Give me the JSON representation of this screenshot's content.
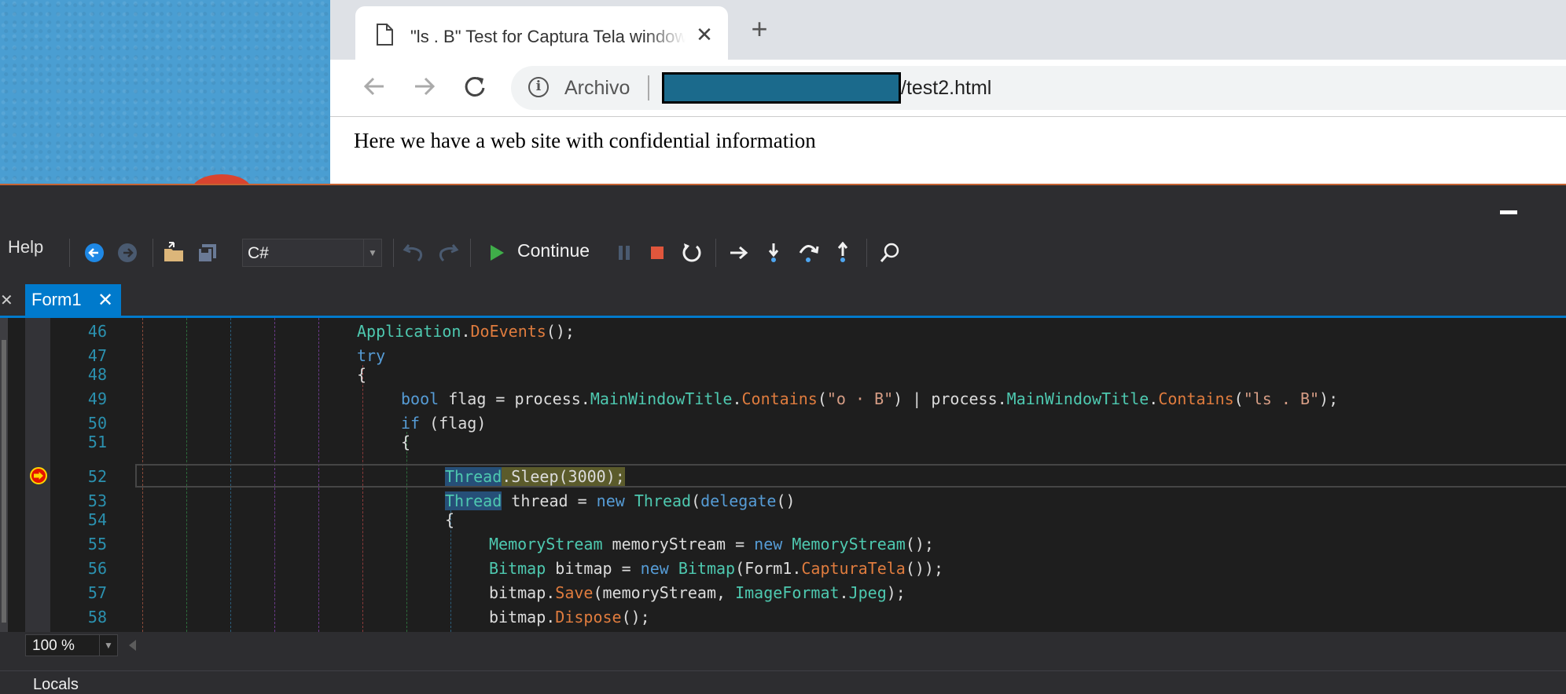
{
  "browser": {
    "tab_title": "\"ls . B\" Test for Captura Tela window",
    "tab_close": "✕",
    "new_tab": "+",
    "scheme_label": "Archivo",
    "url_path": "/test2.html",
    "page_text": "Here we have a web site with confidential information"
  },
  "ide": {
    "menu_help": "Help",
    "language": "C#",
    "continue_label": "Continue",
    "doc_tab": "Form1",
    "doc_tab_close": "✕",
    "zoom": "100 %",
    "locals_label": "Locals",
    "breakpoint_line": 52
  },
  "code": {
    "line_numbers": [
      "46",
      "47",
      "48",
      "49",
      "50",
      "51",
      "52",
      "53",
      "54",
      "55",
      "56",
      "57",
      "58"
    ]
  },
  "colors": {
    "accent": "#007acc",
    "keyword": "#569cd6",
    "type": "#4ec9b0",
    "method": "#e07c3e",
    "string": "#d69d85",
    "line_number": "#2b91af"
  }
}
